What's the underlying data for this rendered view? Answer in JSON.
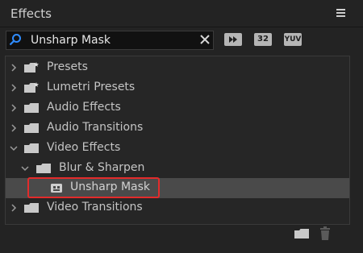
{
  "panel": {
    "title": "Effects"
  },
  "search": {
    "value": "Unsharp Mask"
  },
  "filters": {
    "accelerated": "",
    "b32": "32",
    "yuv": "YUV"
  },
  "tree": {
    "items": [
      {
        "label": "Presets",
        "kind": "preset-bin",
        "expanded": false
      },
      {
        "label": "Lumetri Presets",
        "kind": "preset-bin",
        "expanded": false
      },
      {
        "label": "Audio Effects",
        "kind": "bin",
        "expanded": false
      },
      {
        "label": "Audio Transitions",
        "kind": "bin",
        "expanded": false
      },
      {
        "label": "Video Effects",
        "kind": "bin",
        "expanded": true
      },
      {
        "label": "Blur & Sharpen",
        "kind": "bin",
        "expanded": true
      },
      {
        "label": "Unsharp Mask",
        "kind": "effect",
        "selected": true
      },
      {
        "label": "Video Transitions",
        "kind": "bin",
        "expanded": false
      }
    ]
  },
  "colors": {
    "background": "#232323",
    "selection": "#4a4a4a",
    "highlight": "#e32b2b",
    "search_icon": "#2f8cff"
  }
}
